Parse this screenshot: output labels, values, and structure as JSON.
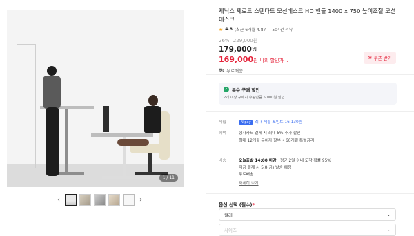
{
  "product": {
    "title": "제닉스 제로드 스탠다드 모션데스크 HD 핸들 1400 x 750 높이조절 모션데스크",
    "rating": "4.8",
    "rating_detail": "(최근 6개월 4.87",
    "reviews": "504건 리뷰",
    "discount_pct": "26%",
    "original_price": "229,000원",
    "price": "179,000",
    "price_unit": "원",
    "my_price": "169,000",
    "my_price_unit": "원",
    "my_price_label": "나의 할인가",
    "shipping": "무료배송"
  },
  "coupon": {
    "label": "쿠폰 받기"
  },
  "gallery": {
    "counter": "1 / 11"
  },
  "bulk": {
    "title": "복수 구매 할인",
    "desc": "2개 이상 구매시 수량만큼 5,000원 할인"
  },
  "info": {
    "points_key": "적립",
    "points_badge": "N pay",
    "points_text": "최대 적립 포인트 16,130원",
    "benefit_key": "혜택",
    "benefit_line1": "행사카드 결제 시 최대 5% 추가 할인",
    "benefit_line2": "최대 12개월 무이자 할부 • 60개월 특별금리",
    "delivery_key": "배송",
    "delivery_line1_bold": "오늘출발 14:00 마감",
    "delivery_line1_rest": "· 평균 2일 이내 도착 확률 95%",
    "delivery_line2": "지금 결제 시 5.8(금) 발송 예정",
    "delivery_line3": "무료배송",
    "delivery_more": "자세히 보기"
  },
  "options": {
    "title": "옵션 선택",
    "required": "(필수)",
    "color_label": "컬러",
    "size_label": "사이즈"
  },
  "colors": {
    "accent": "#e5243b",
    "green": "#23a566",
    "blue": "#3a6df0"
  }
}
